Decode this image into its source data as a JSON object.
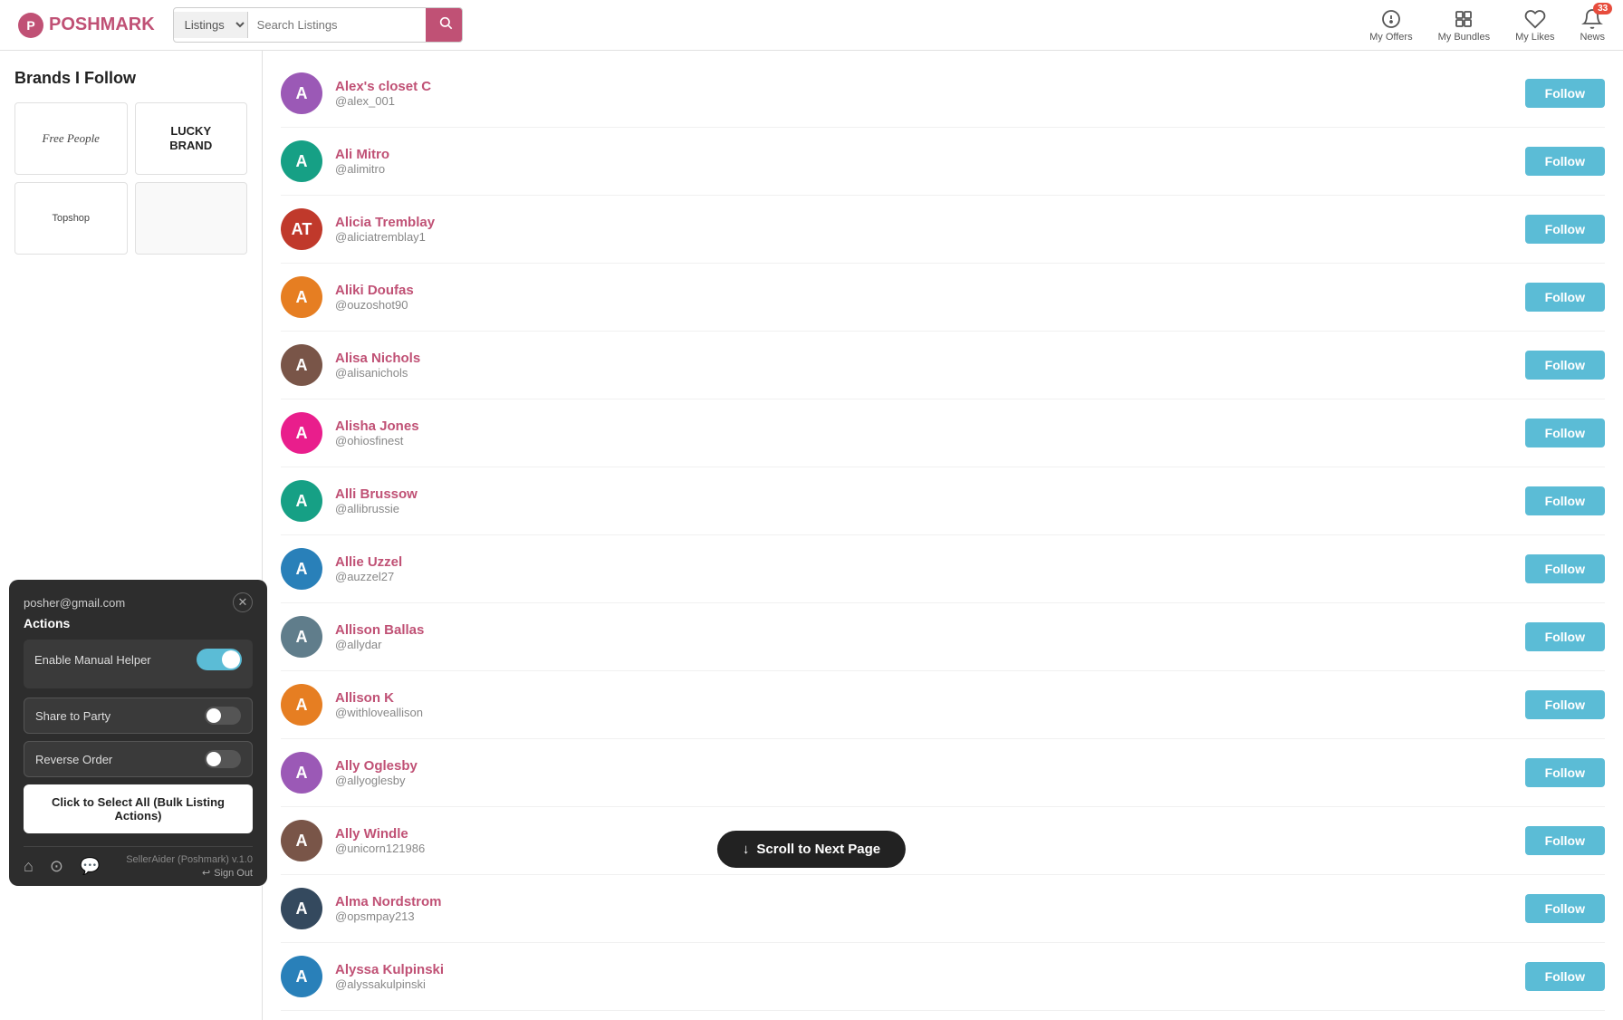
{
  "header": {
    "logo_text": "POSHMARK",
    "search_placeholder": "Search Listings",
    "search_dropdown": "Listings",
    "nav_items": [
      {
        "id": "my-offers",
        "label": "My Offers",
        "icon": "tag"
      },
      {
        "id": "my-bundles",
        "label": "My Bundles",
        "icon": "bundle"
      },
      {
        "id": "my-likes",
        "label": "My Likes",
        "icon": "heart"
      },
      {
        "id": "news",
        "label": "News",
        "icon": "bell",
        "badge": "33"
      }
    ]
  },
  "sidebar": {
    "title": "Brands I Follow",
    "brands": [
      {
        "id": "free-people",
        "name": "Free People",
        "style": "fp"
      },
      {
        "id": "lucky-brand",
        "name": "LUCKY BRAND",
        "style": "lucky"
      },
      {
        "id": "topshop",
        "name": "Topshop",
        "style": "topshop"
      },
      {
        "id": "empty",
        "name": "",
        "style": "empty"
      }
    ]
  },
  "user_list": {
    "users": [
      {
        "id": 1,
        "name": "Alex's closet C",
        "handle": "@alex_001",
        "avatar_color": "av-purple",
        "avatar_text": "A"
      },
      {
        "id": 2,
        "name": "Ali Mitro",
        "handle": "@alimitro",
        "avatar_color": "av-teal",
        "avatar_text": "A"
      },
      {
        "id": 3,
        "name": "Alicia Tremblay",
        "handle": "@aliciatremblay1",
        "avatar_color": "av-red",
        "avatar_text": "AT",
        "initials": true
      },
      {
        "id": 4,
        "name": "Aliki Doufas",
        "handle": "@ouzoshot90",
        "avatar_color": "av-orange",
        "avatar_text": "A"
      },
      {
        "id": 5,
        "name": "Alisa Nichols",
        "handle": "@alisanichols",
        "avatar_color": "av-brown",
        "avatar_text": "A"
      },
      {
        "id": 6,
        "name": "Alisha Jones",
        "handle": "@ohiosfinest",
        "avatar_color": "av-pink",
        "avatar_text": "A"
      },
      {
        "id": 7,
        "name": "Alli Brussow",
        "handle": "@allibrussie",
        "avatar_color": "av-teal",
        "avatar_text": "A"
      },
      {
        "id": 8,
        "name": "Allie Uzzel",
        "handle": "@auzzel27",
        "avatar_color": "av-blue",
        "avatar_text": "A"
      },
      {
        "id": 9,
        "name": "Allison Ballas",
        "handle": "@allydar",
        "avatar_color": "av-gray",
        "avatar_text": "A"
      },
      {
        "id": 10,
        "name": "Allison K",
        "handle": "@withloveallison",
        "avatar_color": "av-orange",
        "avatar_text": "A"
      },
      {
        "id": 11,
        "name": "Ally Oglesby",
        "handle": "@allyoglesby",
        "avatar_color": "av-purple",
        "avatar_text": "A"
      },
      {
        "id": 12,
        "name": "Ally Windle",
        "handle": "@unicorn121986",
        "avatar_color": "av-brown",
        "avatar_text": "A"
      },
      {
        "id": 13,
        "name": "Alma Nordstrom",
        "handle": "@opsmpay213",
        "avatar_color": "av-dark",
        "avatar_text": "A"
      },
      {
        "id": 14,
        "name": "Alyssa Kulpinski",
        "handle": "@alyssakulpinski",
        "avatar_color": "av-blue",
        "avatar_text": "A"
      }
    ],
    "follow_label": "Follow"
  },
  "floating_panel": {
    "email": "posher@gmail.com",
    "actions_title": "Actions",
    "enable_manual_label": "Enable Manual Helper",
    "toggle_number": "1",
    "share_to_party_label": "Share to Party",
    "reverse_order_label": "Reverse Order",
    "bulk_btn_label": "Click to Select All (Bulk Listing Actions)",
    "version": "SellerAider (Poshmark) v.1.0",
    "signout_label": "Sign Out"
  },
  "scroll_btn": {
    "label": "Scroll to Next Page"
  }
}
